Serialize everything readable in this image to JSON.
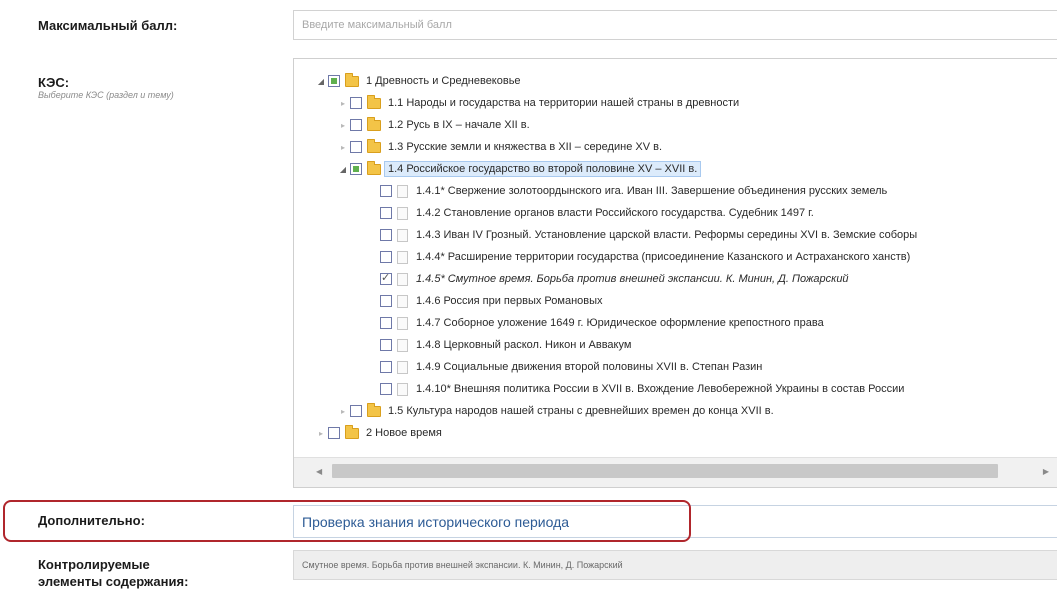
{
  "form": {
    "max_score": {
      "label": "Максимальный балл:",
      "placeholder": "Введите максимальный балл"
    },
    "kes": {
      "label": "КЭС:",
      "hint": "Выберите КЭС (раздел и тему)",
      "tree": [
        {
          "text": "1 Древность и Средневековье",
          "level": 0,
          "toggle": "expanded",
          "check": "partial",
          "icon": "folder-icon"
        },
        {
          "text": "1.1 Народы и государства на территории нашей страны в древности",
          "level": 1,
          "toggle": "collapsed",
          "check": "none",
          "icon": "folder-icon"
        },
        {
          "text": "1.2 Русь в IX – начале XII в.",
          "level": 1,
          "toggle": "collapsed",
          "check": "none",
          "icon": "folder-icon"
        },
        {
          "text": "1.3 Русские земли и княжества в XII – середине XV в.",
          "level": 1,
          "toggle": "collapsed",
          "check": "none",
          "icon": "folder-icon"
        },
        {
          "text": "1.4 Российское государство во второй половине XV – XVII в.",
          "level": 1,
          "toggle": "expanded",
          "check": "partial",
          "icon": "folder-icon",
          "selected": true
        },
        {
          "text": "1.4.1* Свержение золотоордынского ига. Иван III. Завершение объединения русских земель",
          "level": 2,
          "toggle": "",
          "check": "none",
          "icon": "file-icon"
        },
        {
          "text": "1.4.2 Становление органов власти Российского государства. Судебник 1497 г.",
          "level": 2,
          "toggle": "",
          "check": "none",
          "icon": "file-icon"
        },
        {
          "text": "1.4.3 Иван IV Грозный. Установление царской власти. Реформы середины XVI в. Земские соборы",
          "level": 2,
          "toggle": "",
          "check": "none",
          "icon": "file-icon"
        },
        {
          "text": "1.4.4* Расширение территории государства (присоединение Казанского и Астраханского ханств)",
          "level": 2,
          "toggle": "",
          "check": "none",
          "icon": "file-icon"
        },
        {
          "text": "1.4.5* Смутное время. Борьба против внешней экспансии. К. Минин, Д. Пожарский",
          "level": 2,
          "toggle": "",
          "check": "checked",
          "icon": "file-icon"
        },
        {
          "text": "1.4.6 Россия при первых Романовых",
          "level": 2,
          "toggle": "",
          "check": "none",
          "icon": "file-icon"
        },
        {
          "text": "1.4.7 Соборное уложение 1649 г. Юридическое оформление крепостного права",
          "level": 2,
          "toggle": "",
          "check": "none",
          "icon": "file-icon"
        },
        {
          "text": "1.4.8 Церковный раскол. Никон и Аввакум",
          "level": 2,
          "toggle": "",
          "check": "none",
          "icon": "file-icon"
        },
        {
          "text": "1.4.9 Социальные движения второй половины XVII в. Степан Разин",
          "level": 2,
          "toggle": "",
          "check": "none",
          "icon": "file-icon"
        },
        {
          "text": "1.4.10* Внешняя политика России в XVII в. Вхождение Левобережной Украины в состав России",
          "level": 2,
          "toggle": "",
          "check": "none",
          "icon": "file-icon"
        },
        {
          "text": "1.5 Культура народов нашей страны с древнейших времен до конца XVII в.",
          "level": 1,
          "toggle": "collapsed",
          "check": "none",
          "icon": "folder-icon"
        },
        {
          "text": "2 Новое время",
          "level": 0,
          "toggle": "collapsed",
          "check": "none",
          "icon": "folder-icon"
        }
      ]
    },
    "extra": {
      "label": "Дополнительно:",
      "value": "Проверка знания исторического периода"
    },
    "controlled": {
      "label_line1": "Контролируемые",
      "label_line2": "элементы содержания:",
      "value": "Смутное время. Борьба против внешней экспансии. К. Минин, Д. Пожарский"
    }
  },
  "colors": {
    "highlight_frame": "#b0262c",
    "partial_check": "#5fb04e",
    "folder": "#f3c447"
  }
}
